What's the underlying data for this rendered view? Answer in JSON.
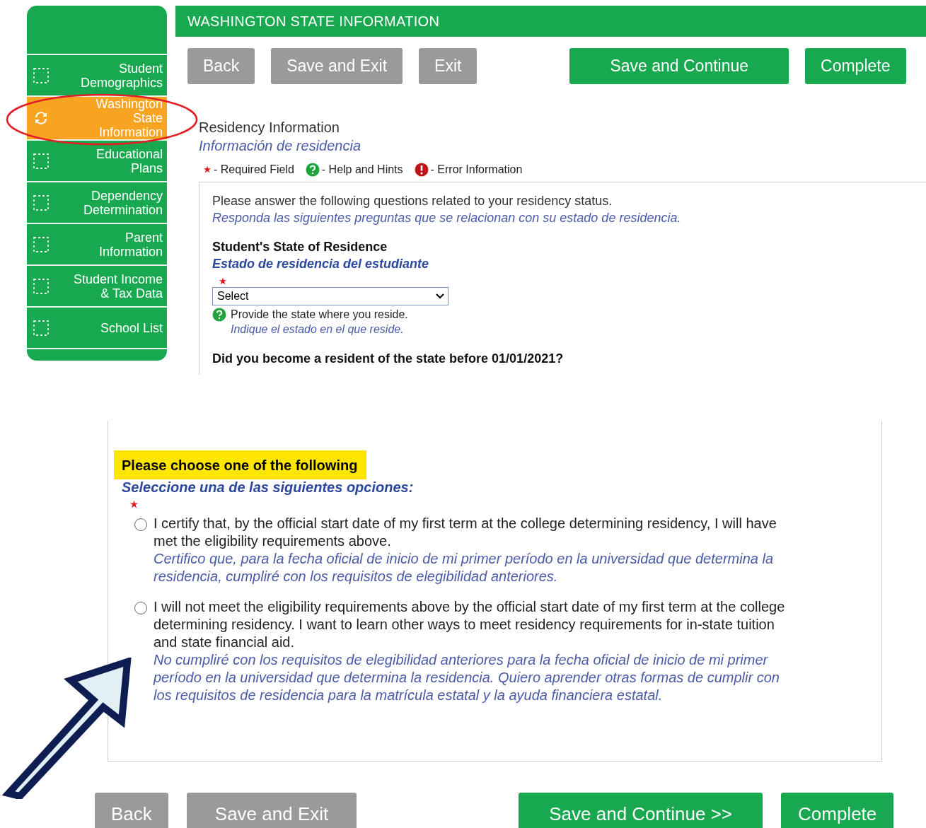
{
  "sidebar": {
    "items": [
      {
        "label": "Student Demographics",
        "selected": false
      },
      {
        "label": "Washington State Information",
        "selected": true
      },
      {
        "label": "Educational Plans",
        "selected": false
      },
      {
        "label": "Dependency Determination",
        "selected": false
      },
      {
        "label": "Parent Information",
        "selected": false
      },
      {
        "label": "Student Income & Tax Data",
        "selected": false
      },
      {
        "label": "School List",
        "selected": false
      }
    ]
  },
  "header": {
    "title": "WASHINGTON STATE INFORMATION"
  },
  "top_buttons": [
    {
      "label": "Back",
      "kind": "secondary"
    },
    {
      "label": "Save and Exit",
      "kind": "secondary"
    },
    {
      "label": "Exit",
      "kind": "secondary"
    },
    {
      "label": "Save and Continue",
      "kind": "primary"
    },
    {
      "label": "Complete",
      "kind": "primary"
    }
  ],
  "section": {
    "title": "Residency Information",
    "title_es": "Información de residencia"
  },
  "legend": [
    {
      "kind": "required",
      "label": "- Required Field"
    },
    {
      "kind": "help",
      "label": "- Help and Hints"
    },
    {
      "kind": "error",
      "label": "- Error Information"
    }
  ],
  "intro": {
    "text": "Please answer the following questions related to your residency status.",
    "text_es": "Responda las siguientes preguntas que se relacionan con su estado de residencia."
  },
  "state_field": {
    "label": "Student's State of Residence",
    "label_es": "Estado de residencia del estudiante",
    "value": "Select",
    "hint": "Provide the state where you reside.",
    "hint_es": "Indique el estado en el que reside."
  },
  "question": {
    "text": "Did you become a resident of the state before 01/01/2021?"
  },
  "choices": {
    "heading": "Please choose one of the following",
    "heading_es": "Seleccione una de las siguientes opciones:",
    "options": [
      {
        "text": "I certify that, by the official start date of my first term at the college determining residency, I will have met the eligibility requirements above.",
        "text_es": "Certifico que, para la fecha oficial de inicio de mi primer período en la universidad que determina la residencia, cumpliré con los requisitos de elegibilidad anteriores.",
        "selected": false
      },
      {
        "text": "I will not meet the eligibility requirements above by the official start date of my first term at the college determining residency. I want to learn other ways to meet residency requirements for in-state tuition and state financial aid.",
        "text_es": "No cumpliré con los requisitos de elegibilidad anteriores para la fecha oficial de inicio de mi primer período en la universidad que determina la residencia. Quiero aprender otras formas de cumplir con los requisitos de residencia para la matrícula estatal y la ayuda financiera estatal.",
        "selected": false
      }
    ]
  },
  "bottom_buttons": [
    {
      "label": "Back",
      "kind": "secondary"
    },
    {
      "label": "Save and Exit",
      "kind": "secondary"
    },
    {
      "label": "Save and Continue >>",
      "kind": "primary"
    },
    {
      "label": "Complete",
      "kind": "primary"
    }
  ]
}
